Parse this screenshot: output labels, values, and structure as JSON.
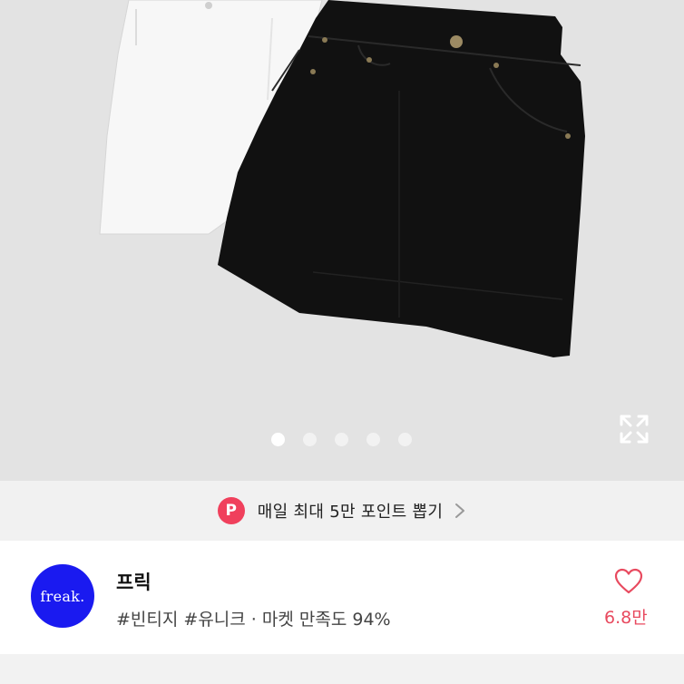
{
  "product_image": {
    "slide_count": 5,
    "active_slide": 1,
    "alt_icon": "expand-icon"
  },
  "banner": {
    "badge": "P",
    "text": "매일 최대 5만 포인트 뽑기",
    "icon": "chevron-right-icon"
  },
  "store": {
    "logo_text": "freak.",
    "name": "프릭",
    "tags": "#빈티지 #유니크 · 마켓 만족도 94%",
    "like_icon": "heart-outline-icon",
    "like_count": "6.8만"
  },
  "colors": {
    "accent_red": "#e84a5f",
    "badge_pink": "#f0405c",
    "logo_blue": "#1a1af0",
    "image_bg": "#e3e3e3"
  }
}
